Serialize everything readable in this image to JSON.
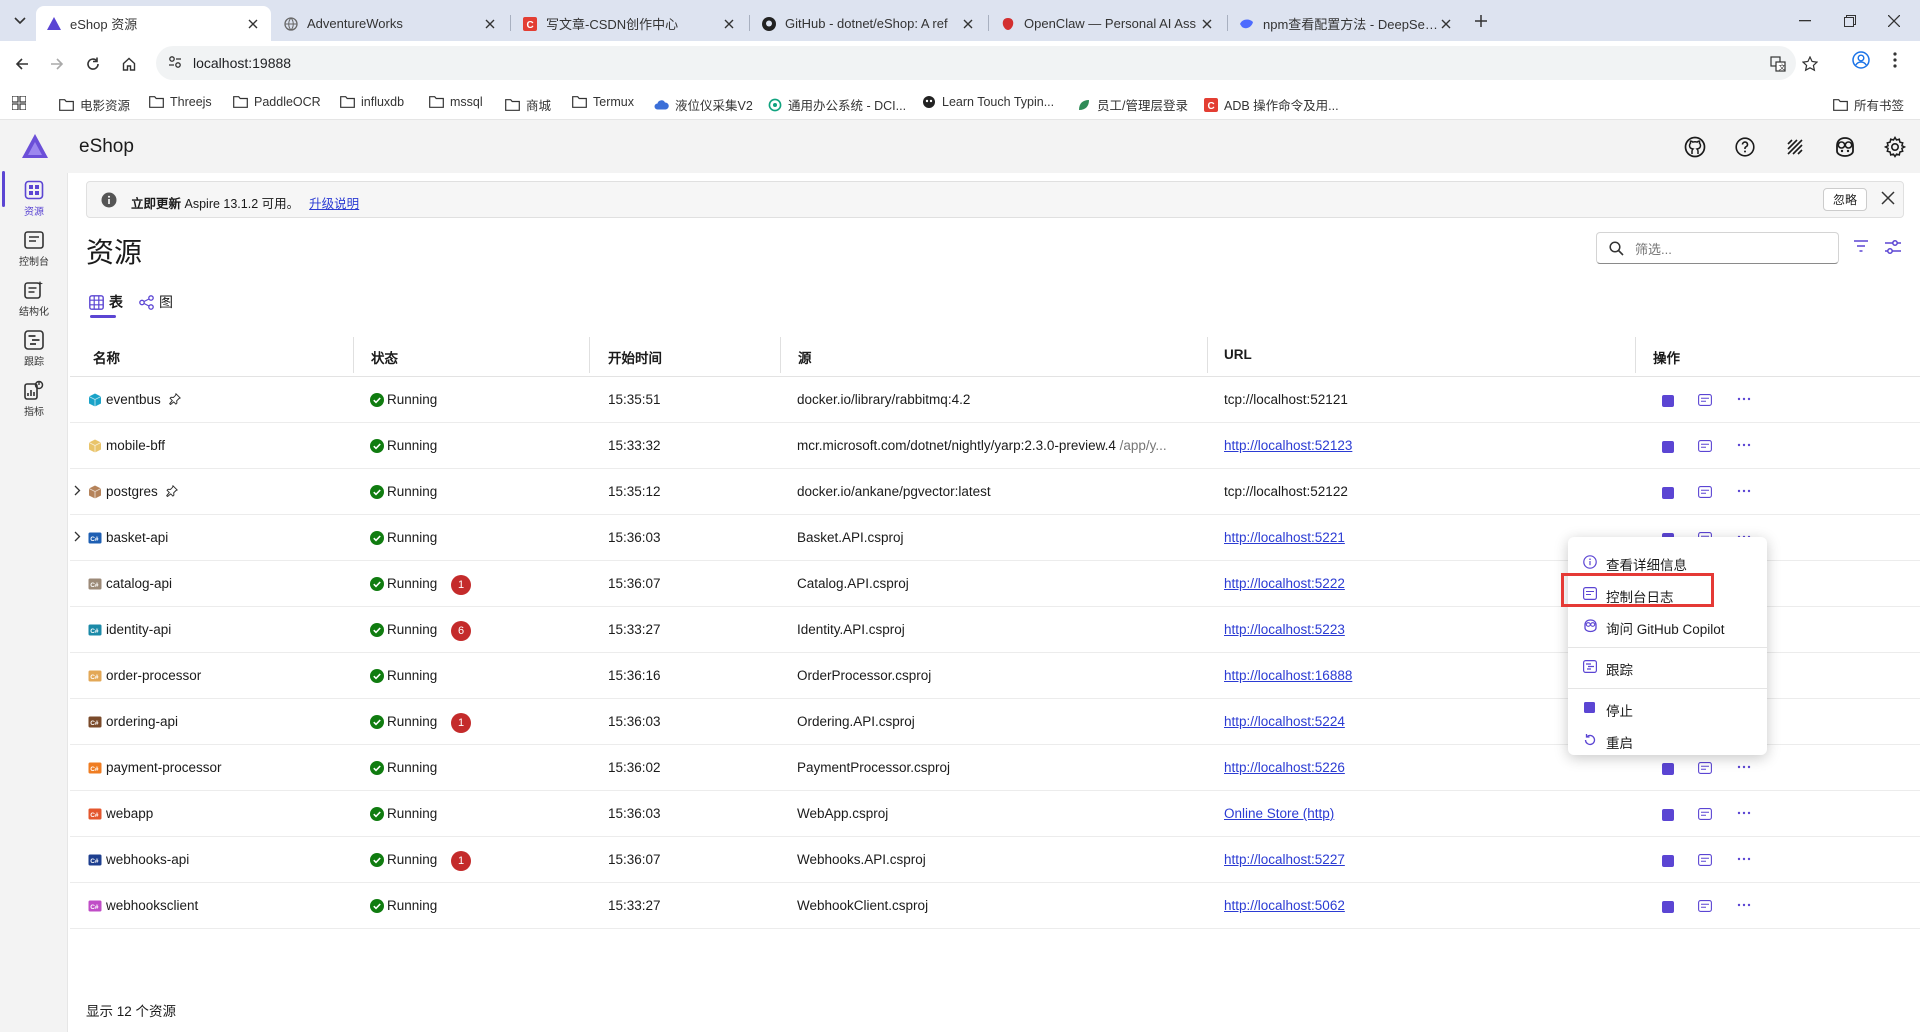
{
  "browser": {
    "tabs": [
      {
        "title": "eShop 资源",
        "active": true
      },
      {
        "title": "AdventureWorks"
      },
      {
        "title": "写文章-CSDN创作中心"
      },
      {
        "title": "GitHub - dotnet/eShop: A ref"
      },
      {
        "title": "OpenClaw — Personal AI Ass"
      },
      {
        "title": "npm查看配置方法 - DeepSeek"
      }
    ],
    "address": "localhost:19888",
    "bookmarks": [
      "电影资源",
      "Threejs",
      "PaddleOCR",
      "influxdb",
      "mssql",
      "商城",
      "Termux",
      "液位仪采集V2",
      "通用办公系统 - DCI...",
      "Learn Touch Typin...",
      "员工/管理层登录",
      "ADB 操作命令及用..."
    ],
    "all_bookmarks": "所有书签"
  },
  "app": {
    "name": "eShop",
    "nav": [
      {
        "label": "资源",
        "icon": "grid-icon"
      },
      {
        "label": "控制台",
        "icon": "console-icon"
      },
      {
        "label": "结构化",
        "icon": "structured-logs-icon"
      },
      {
        "label": "跟踪",
        "icon": "traces-icon"
      },
      {
        "label": "指标",
        "icon": "metrics-icon"
      }
    ],
    "banner": {
      "strong": "立即更新",
      "text": "Aspire 13.1.2 可用。",
      "link": "升级说明",
      "dismiss": "忽略"
    },
    "page_title": "资源",
    "filter_placeholder": "筛选...",
    "view_tabs": {
      "table": "表",
      "graph": "图"
    },
    "columns": {
      "name": "名称",
      "status": "状态",
      "start": "开始时间",
      "source": "源",
      "url": "URL",
      "actions": "操作"
    },
    "rows": [
      {
        "name": "eventbus",
        "status": "Running",
        "start": "15:35:51",
        "source": "docker.io/library/rabbitmq:4.2",
        "source_extra": "",
        "url": "tcp://localhost:52121",
        "url_link": false,
        "badge": "",
        "pinned": true,
        "expandable": false,
        "icon_color": "#1aa3c8",
        "icon": "container-icon"
      },
      {
        "name": "mobile-bff",
        "status": "Running",
        "start": "15:33:32",
        "source": "mcr.microsoft.com/dotnet/nightly/yarp:2.3.0-preview.4",
        "source_extra": "/app/y...",
        "url": "http://localhost:52123",
        "url_link": true,
        "badge": "",
        "pinned": false,
        "expandable": false,
        "icon_color": "#e9c46a",
        "icon": "container-icon"
      },
      {
        "name": "postgres",
        "status": "Running",
        "start": "15:35:12",
        "source": "docker.io/ankane/pgvector:latest",
        "source_extra": "",
        "url": "tcp://localhost:52122",
        "url_link": false,
        "badge": "",
        "pinned": true,
        "expandable": true,
        "icon_color": "#b5835a",
        "icon": "container-icon"
      },
      {
        "name": "basket-api",
        "status": "Running",
        "start": "15:36:03",
        "source": "Basket.API.csproj",
        "source_extra": "",
        "url": "http://localhost:5221",
        "url_link": true,
        "badge": "",
        "pinned": false,
        "expandable": true,
        "icon_color": "#1e5fb3",
        "icon": "project-icon"
      },
      {
        "name": "catalog-api",
        "status": "Running",
        "start": "15:36:07",
        "source": "Catalog.API.csproj",
        "source_extra": "",
        "url": "http://localhost:5222",
        "url_link": true,
        "badge": "1",
        "pinned": false,
        "expandable": false,
        "icon_color": "#9c8a78",
        "icon": "project-icon"
      },
      {
        "name": "identity-api",
        "status": "Running",
        "start": "15:33:27",
        "source": "Identity.API.csproj",
        "source_extra": "",
        "url": "http://localhost:5223",
        "url_link": true,
        "badge": "6",
        "pinned": false,
        "expandable": false,
        "icon_color": "#1b8aa8",
        "icon": "project-icon"
      },
      {
        "name": "order-processor",
        "status": "Running",
        "start": "15:36:16",
        "source": "OrderProcessor.csproj",
        "source_extra": "",
        "url": "http://localhost:16888",
        "url_link": true,
        "badge": "",
        "pinned": false,
        "expandable": false,
        "icon_color": "#e3a857",
        "icon": "project-icon"
      },
      {
        "name": "ordering-api",
        "status": "Running",
        "start": "15:36:03",
        "source": "Ordering.API.csproj",
        "source_extra": "",
        "url": "http://localhost:5224",
        "url_link": true,
        "badge": "1",
        "pinned": false,
        "expandable": false,
        "icon_color": "#7a4a2a",
        "icon": "project-icon"
      },
      {
        "name": "payment-processor",
        "status": "Running",
        "start": "15:36:02",
        "source": "PaymentProcessor.csproj",
        "source_extra": "",
        "url": "http://localhost:5226",
        "url_link": true,
        "badge": "",
        "pinned": false,
        "expandable": false,
        "icon_color": "#ef7d22",
        "icon": "project-icon"
      },
      {
        "name": "webapp",
        "status": "Running",
        "start": "15:36:03",
        "source": "WebApp.csproj",
        "source_extra": "",
        "url": "Online Store (http)",
        "url_link": true,
        "badge": "",
        "pinned": false,
        "expandable": false,
        "icon_color": "#e4572e",
        "icon": "project-icon"
      },
      {
        "name": "webhooks-api",
        "status": "Running",
        "start": "15:36:07",
        "source": "Webhooks.API.csproj",
        "source_extra": "",
        "url": "http://localhost:5227",
        "url_link": true,
        "badge": "1",
        "pinned": false,
        "expandable": false,
        "icon_color": "#1e3f8f",
        "icon": "project-icon"
      },
      {
        "name": "webhooksclient",
        "status": "Running",
        "start": "15:33:27",
        "source": "WebhookClient.csproj",
        "source_extra": "",
        "url": "http://localhost:5062",
        "url_link": true,
        "badge": "",
        "pinned": false,
        "expandable": false,
        "icon_color": "#c04dc7",
        "icon": "project-icon"
      }
    ],
    "footer": "显示 12 个资源",
    "context_menu": [
      {
        "label": "查看详细信息",
        "icon": "info-icon"
      },
      {
        "label": "控制台日志",
        "icon": "console-log-icon"
      },
      {
        "label": "询问 GitHub Copilot",
        "icon": "copilot-icon"
      },
      {
        "label": "跟踪",
        "icon": "traces-icon"
      },
      {
        "label": "停止",
        "icon": "stop-icon"
      },
      {
        "label": "重启",
        "icon": "restart-icon"
      }
    ],
    "colors": {
      "accent": "#5b45d3",
      "running": "#107c10",
      "error_badge": "#c42b2b",
      "link": "#2b3bd3",
      "highlight": "#e53935"
    }
  }
}
